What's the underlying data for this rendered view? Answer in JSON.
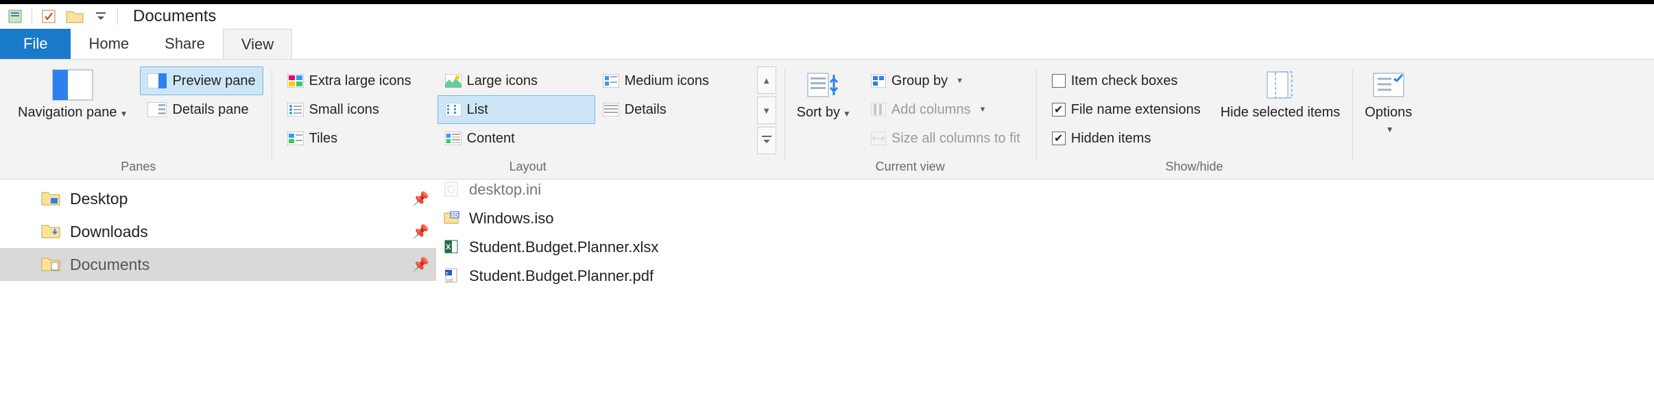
{
  "window": {
    "title": "Documents"
  },
  "tabs": {
    "file": "File",
    "items": [
      {
        "label": "Home",
        "active": false
      },
      {
        "label": "Share",
        "active": false
      },
      {
        "label": "View",
        "active": true
      }
    ]
  },
  "ribbon": {
    "panes": {
      "label": "Panes",
      "navigation": "Navigation pane",
      "preview": "Preview pane",
      "details": "Details pane"
    },
    "layout": {
      "label": "Layout",
      "items": [
        "Extra large icons",
        "Large icons",
        "Medium icons",
        "Small icons",
        "List",
        "Details",
        "Tiles",
        "Content"
      ],
      "selected": "List"
    },
    "current_view": {
      "label": "Current view",
      "sort_by": "Sort by",
      "group_by": "Group by",
      "add_cols": "Add columns",
      "size_all": "Size all columns to fit"
    },
    "show_hide": {
      "label": "Show/hide",
      "item_check": {
        "label": "Item check boxes",
        "checked": false
      },
      "extensions": {
        "label": "File name extensions",
        "checked": true
      },
      "hidden": {
        "label": "Hidden items",
        "checked": true
      },
      "hide_sel": "Hide selected items"
    },
    "options": "Options"
  },
  "nav": {
    "items": [
      {
        "label": "Desktop",
        "pinned": true,
        "selected": false,
        "icon": "desktop"
      },
      {
        "label": "Downloads",
        "pinned": true,
        "selected": false,
        "icon": "downloads"
      },
      {
        "label": "Documents",
        "pinned": true,
        "selected": true,
        "icon": "documents"
      }
    ]
  },
  "files": [
    {
      "name": "desktop.ini",
      "icon": "ini",
      "cut": true
    },
    {
      "name": "Windows.iso",
      "icon": "iso",
      "cut": false
    },
    {
      "name": "Student.Budget.Planner.xlsx",
      "icon": "xlsx",
      "cut": false
    },
    {
      "name": "Student.Budget.Planner.pdf",
      "icon": "pdf",
      "cut": false
    }
  ]
}
